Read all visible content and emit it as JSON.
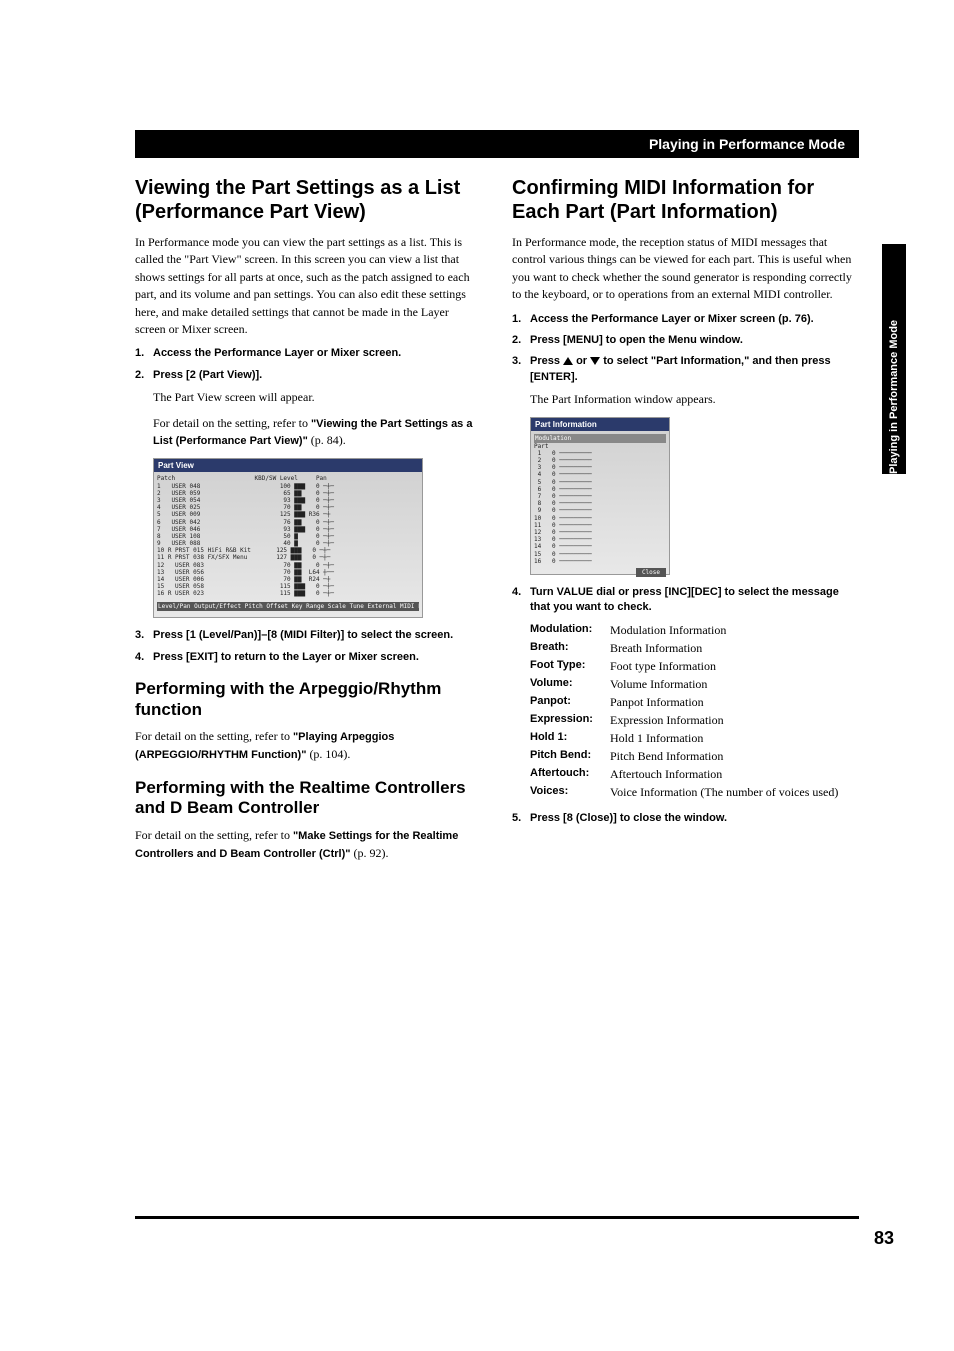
{
  "page": {
    "header_title": "Playing in Performance Mode",
    "side_tab": "Playing in Performance Mode",
    "number": "83"
  },
  "left": {
    "h1": "Viewing the Part Settings as a List (Performance Part View)",
    "intro": "In Performance mode you can view the part settings as a list. This is called the \"Part View\" screen. In this screen you can view a list that shows settings for all parts at once, such as the patch assigned to each part, and its volume and pan settings. You can also edit these settings here, and make detailed settings that cannot be made in the Layer screen or Mixer screen.",
    "steps": [
      {
        "n": "1.",
        "t": "Access the Performance Layer or Mixer screen."
      },
      {
        "n": "2.",
        "t": "Press [2 (Part View)]."
      }
    ],
    "step2_desc_a": "The Part View screen will appear.",
    "step2_desc_b_pre": "For detail on the setting, refer to ",
    "step2_desc_b_bold": "\"Viewing the Part Settings as a List (Performance Part View)\"",
    "step2_desc_b_post": " (p. 84).",
    "screenshot_title": "Part View",
    "steps2": [
      {
        "n": "3.",
        "t": "Press [1 (Level/Pan)]–[8 (MIDI Filter)] to select the screen."
      },
      {
        "n": "4.",
        "t": "Press [EXIT] to return to the Layer or Mixer screen."
      }
    ],
    "h2a": "Performing with the Arpeggio/Rhythm function",
    "p2a_pre": "For detail on the setting, refer to ",
    "p2a_bold": "\"Playing Arpeggios (ARPEGGIO/RHYTHM Function)\"",
    "p2a_post": " (p. 104).",
    "h2b": "Performing with the Realtime Controllers and D Beam Controller",
    "p2b_pre": "For detail on the setting, refer to ",
    "p2b_bold": "\"Make Settings for the Realtime Controllers and D Beam Controller (Ctrl)\"",
    "p2b_post": " (p. 92)."
  },
  "right": {
    "h1": "Confirming MIDI Information for Each Part (Part Information)",
    "intro": "In Performance mode, the reception status of MIDI messages that control various things can be viewed for each part. This is useful when you want to check whether the sound generator is responding correctly to the keyboard, or to operations from an external MIDI controller.",
    "steps": [
      {
        "n": "1.",
        "t": "Access the Performance Layer or Mixer screen (p. 76)."
      },
      {
        "n": "2.",
        "t": "Press [MENU] to open the Menu window."
      }
    ],
    "step3": {
      "n": "3.",
      "pre": "Press ",
      "mid": " or ",
      "post": " to select \"Part Information,\" and then press [ENTER]."
    },
    "step3_desc": "The Part Information window appears.",
    "screenshot_title": "Part Information",
    "screenshot_sub": "Modulation",
    "step4": {
      "n": "4.",
      "t": "Turn VALUE dial or press [INC][DEC] to select the message that you want to check."
    },
    "info": [
      {
        "label": "Modulation:",
        "value": "Modulation Information"
      },
      {
        "label": "Breath:",
        "value": "Breath Information"
      },
      {
        "label": "Foot Type:",
        "value": "Foot type Information"
      },
      {
        "label": "Volume:",
        "value": "Volume Information"
      },
      {
        "label": "Panpot:",
        "value": "Panpot Information"
      },
      {
        "label": "Expression:",
        "value": "Expression Information"
      },
      {
        "label": "Hold 1:",
        "value": "Hold 1 Information"
      },
      {
        "label": "Pitch Bend:",
        "value": "Pitch Bend Information"
      },
      {
        "label": "Aftertouch:",
        "value": "Aftertouch Information"
      },
      {
        "label": "Voices:",
        "value": "Voice Information (The number of voices used)"
      }
    ],
    "step5": {
      "n": "5.",
      "t": "Press [8 (Close)] to close the window."
    }
  }
}
